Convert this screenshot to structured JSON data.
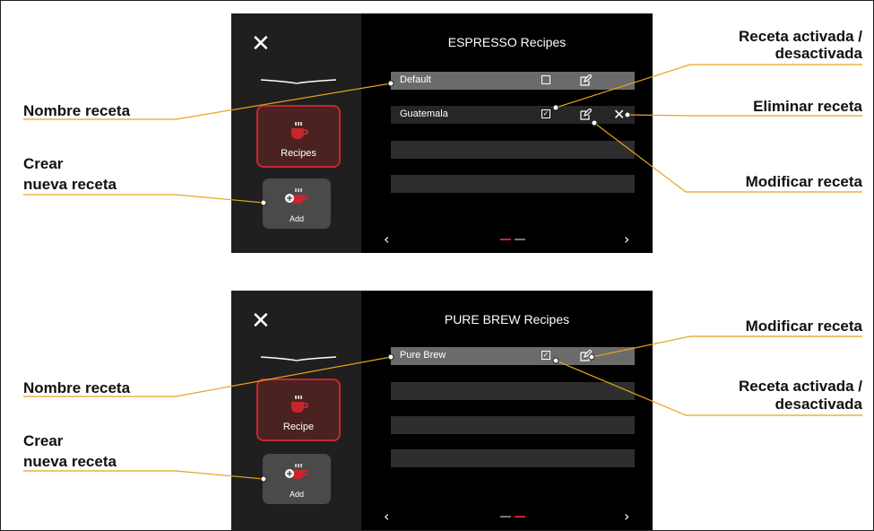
{
  "colors": {
    "accent": "#c6262e",
    "leader": "#e8a21a"
  },
  "panels": [
    {
      "title": "ESPRESSO Recipes",
      "mode_label": "Recipes",
      "add_label": "Add",
      "recipes": [
        {
          "name": "Default",
          "active": false,
          "selected": true
        },
        {
          "name": "Guatemala",
          "active": true,
          "selected": false,
          "deletable": true
        }
      ],
      "page_indicator": {
        "pages": 2,
        "current": 1
      }
    },
    {
      "title": "PURE BREW Recipes",
      "mode_label": "Recipe",
      "add_label": "Add",
      "recipes": [
        {
          "name": "Pure Brew",
          "active": true,
          "selected": true
        }
      ],
      "page_indicator": {
        "pages": 2,
        "current": 2
      }
    }
  ],
  "callouts": {
    "top": {
      "recipe_name": "Nombre receta",
      "create_line1": "Crear",
      "create_line2": "nueva receta",
      "activated_line1": "Receta activada /",
      "activated_line2": "desactivada",
      "delete": "Eliminar receta",
      "modify": "Modificar receta"
    },
    "bottom": {
      "recipe_name": "Nombre receta",
      "create_line1": "Crear",
      "create_line2": "nueva receta",
      "modify": "Modificar receta",
      "activated_line1": "Receta activada /",
      "activated_line2": "desactivada"
    }
  }
}
